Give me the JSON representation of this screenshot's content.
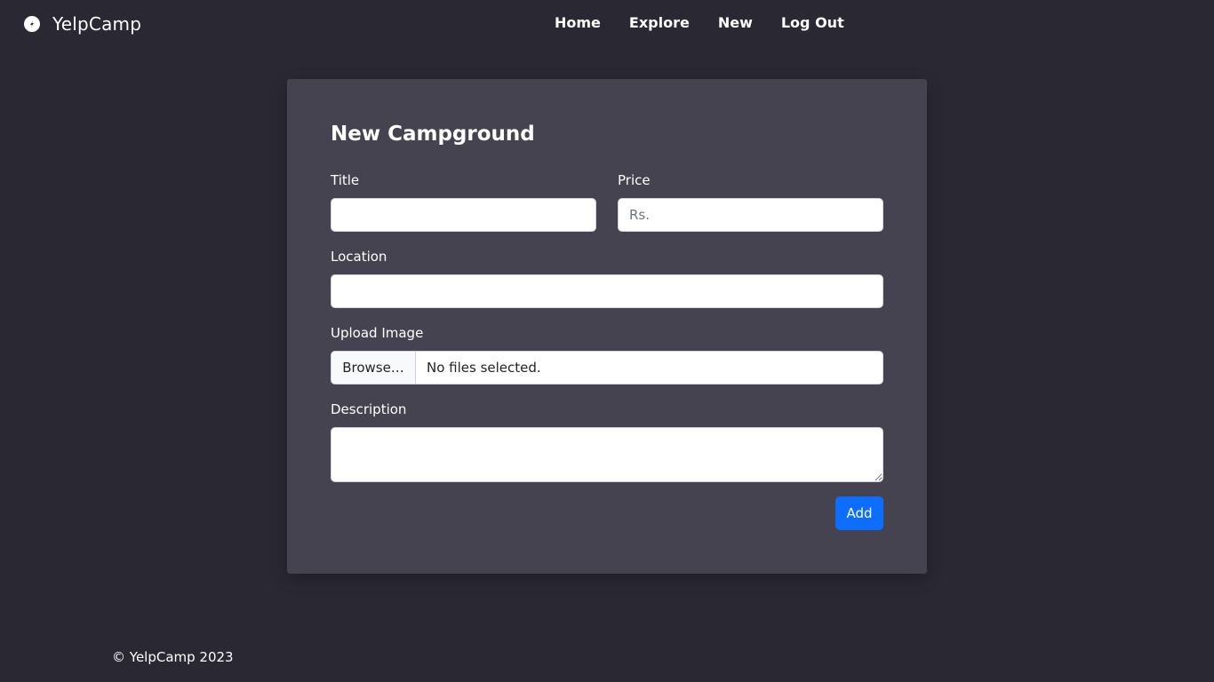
{
  "navbar": {
    "brand": "YelpCamp",
    "brand_icon": "compass-icon",
    "links": [
      {
        "label": "Home"
      },
      {
        "label": "Explore"
      },
      {
        "label": "New"
      },
      {
        "label": "Log Out"
      }
    ]
  },
  "form": {
    "title": "New Campground",
    "title_label": "Title",
    "title_value": "",
    "price_label": "Price",
    "price_placeholder": "Rs.",
    "location_label": "Location",
    "location_value": "",
    "upload_label": "Upload Image",
    "browse_label": "Browse…",
    "file_status": "No files selected.",
    "description_label": "Description",
    "description_value": "",
    "submit_label": "Add"
  },
  "footer": {
    "text": "© YelpCamp 2023"
  },
  "colors": {
    "background": "#2a2833",
    "card": "#45434f",
    "primary": "#0d6efd"
  }
}
